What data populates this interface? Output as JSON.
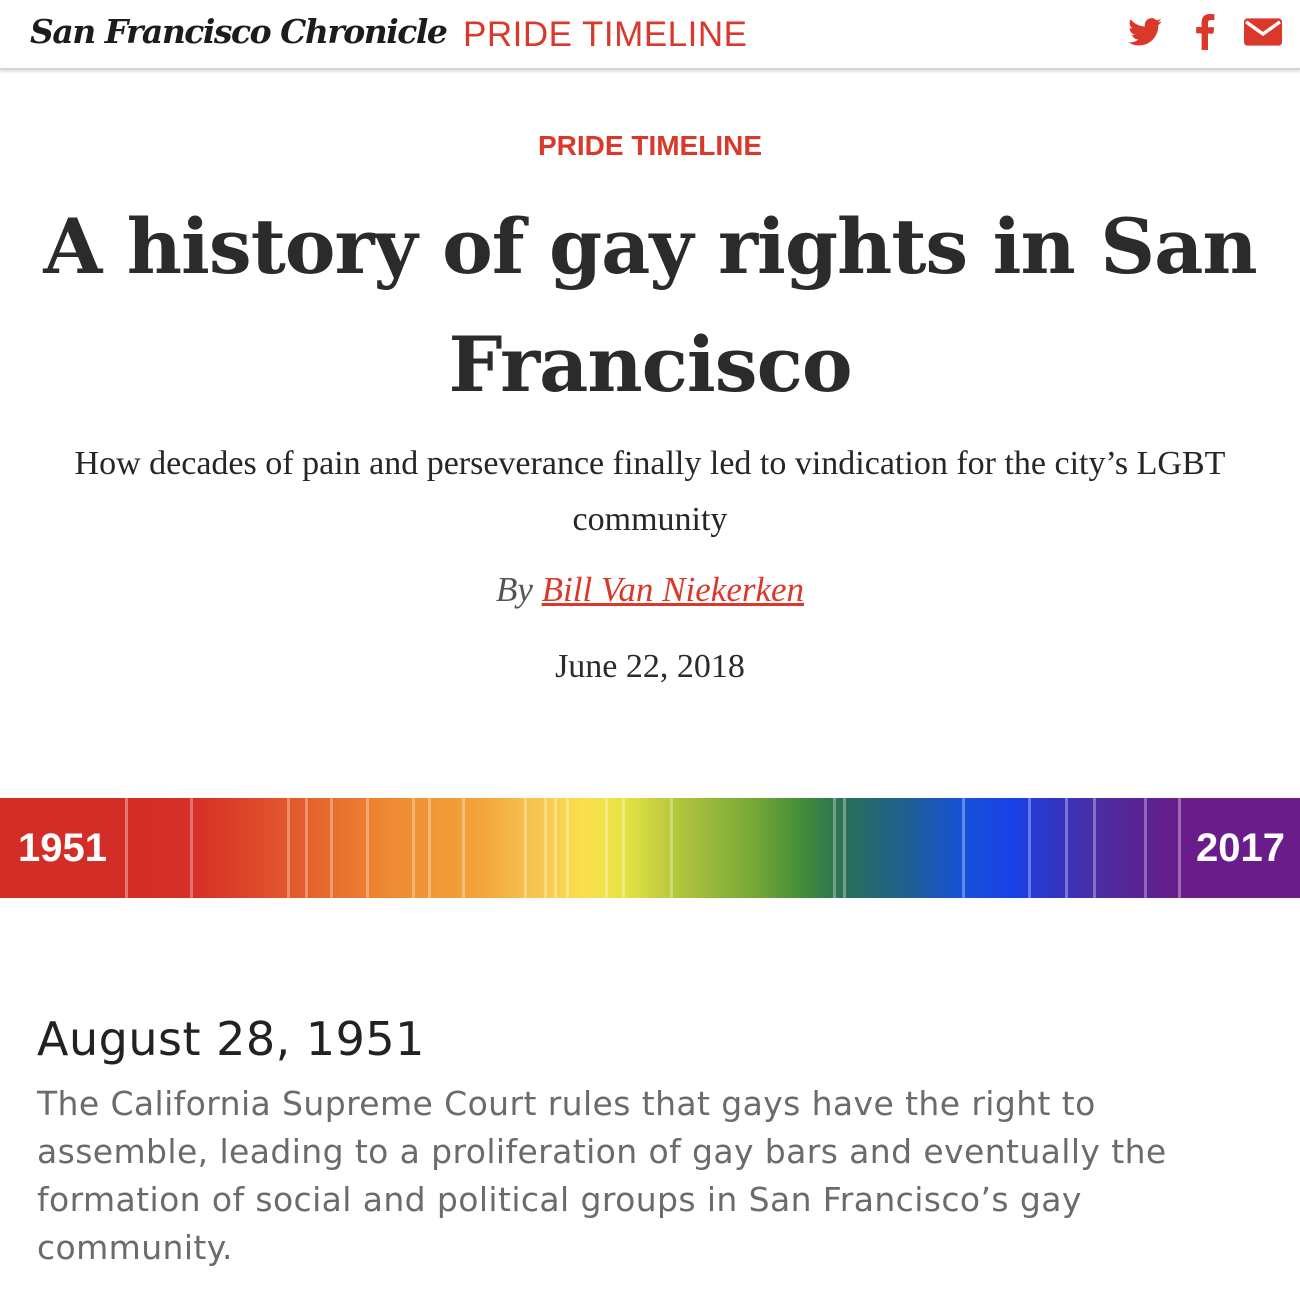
{
  "nav": {
    "masthead": "San Francisco Chronicle",
    "section_link": "PRIDE TIMELINE",
    "share_icons": [
      "twitter-icon",
      "facebook-icon",
      "email-icon"
    ],
    "accent_color": "#d9382b"
  },
  "header": {
    "kicker": "PRIDE TIMELINE",
    "title": "A history of gay rights in San Francisco",
    "dek": "How decades of pain and perseverance finally led to vindication for the city’s LGBT community",
    "byline_prefix": "By",
    "author": "Bill Van Niekerken",
    "date": "June 22, 2018"
  },
  "timeline": {
    "start_year": "1951",
    "end_year": "2017"
  },
  "entry": {
    "date": "August 28, 1951",
    "text": "The California Supreme Court rules that gays have the right to assemble, leading to a proliferation of gay bars and eventually the formation of social and political groups in San Francisco’s gay community."
  }
}
